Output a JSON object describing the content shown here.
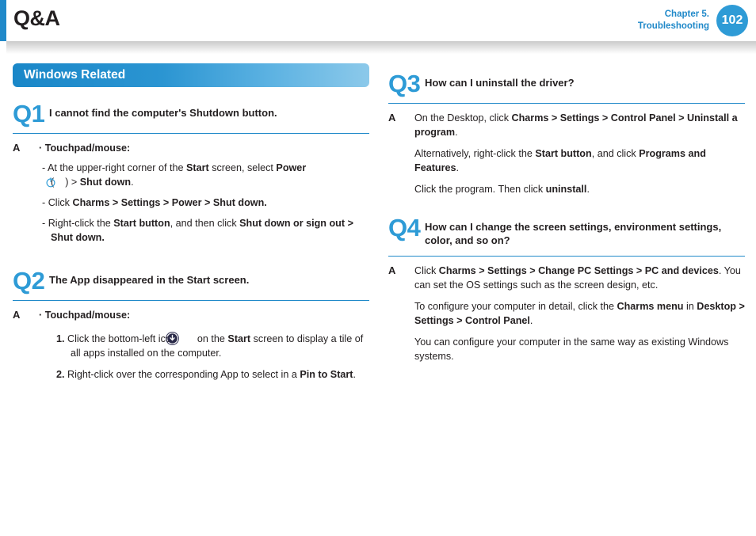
{
  "header": {
    "title": "Q&A",
    "chapter_line1": "Chapter 5.",
    "chapter_line2": "Troubleshooting",
    "page_number": "102",
    "accent_color": "#2089c9",
    "page_circle_color": "#2e9bd6"
  },
  "left_column": {
    "section_banner": "Windows Related",
    "qa": [
      {
        "q_label": "Q1",
        "question": "I cannot find the computer's Shutdown button.",
        "a_label": "A",
        "bullet_head": "· Touchpad/mouse:",
        "items": [
          {
            "prefix": "- At the upper-right corner of the ",
            "b1": "Start",
            "mid": " screen, select ",
            "b2": "Power",
            "after_icon": ") > ",
            "b3": "Shut down",
            "tail": "."
          },
          {
            "prefix": "- Click ",
            "b1": "Charms > Settings > Power > Shut down.",
            "mid": "",
            "b2": "",
            "tail": ""
          },
          {
            "prefix": "- Right-click the ",
            "b1": "Start button",
            "mid": ", and then click ",
            "b2": "Shut down or sign out > Shut down.",
            "tail": ""
          }
        ]
      },
      {
        "q_label": "Q2",
        "question": "The App disappeared in the Start screen.",
        "a_label": "A",
        "bullet_head": "· Touchpad/mouse:",
        "numbered": [
          {
            "marker": "1.",
            "prefix": " Click the bottom-left icon ",
            "mid": " on the ",
            "b1": "Start",
            "tail": " screen to display a tile of all apps installed on the computer."
          },
          {
            "marker": "2.",
            "prefix": " Right-click over the corresponding App to select in a ",
            "b1": "Pin to Start",
            "tail": "."
          }
        ]
      }
    ]
  },
  "right_column": {
    "qa": [
      {
        "q_label": "Q3",
        "question": "How can I uninstall the driver?",
        "a_label": "A",
        "paragraphs": [
          {
            "p1": "On the Desktop, click ",
            "b1": "Charms > Settings > Control Panel > Uninstall a program",
            "p2": "."
          },
          {
            "p1": "Alternatively, right-click the ",
            "b1": "Start button",
            "p2": ", and click ",
            "b2": "Programs and Features",
            "p3": "."
          },
          {
            "p1": "Click the program. Then click ",
            "b1": "uninstall",
            "p2": "."
          }
        ]
      },
      {
        "q_label": "Q4",
        "question": "How can I change the screen settings, environment settings, color, and so on?",
        "a_label": "A",
        "paragraphs": [
          {
            "p1": "Click ",
            "b1": "Charms > Settings > Change PC Settings > PC and devices",
            "p2": ". You can set the OS settings such as the screen design, etc."
          },
          {
            "p1": "To configure your computer in detail, click the ",
            "b1": "Charms menu",
            "p2": " in ",
            "b2": "Desktop > Settings > Control Panel",
            "p3": "."
          },
          {
            "p1": "You can configure your computer in the same way as existing Windows systems.",
            "b1": "",
            "p2": ""
          }
        ]
      }
    ]
  }
}
